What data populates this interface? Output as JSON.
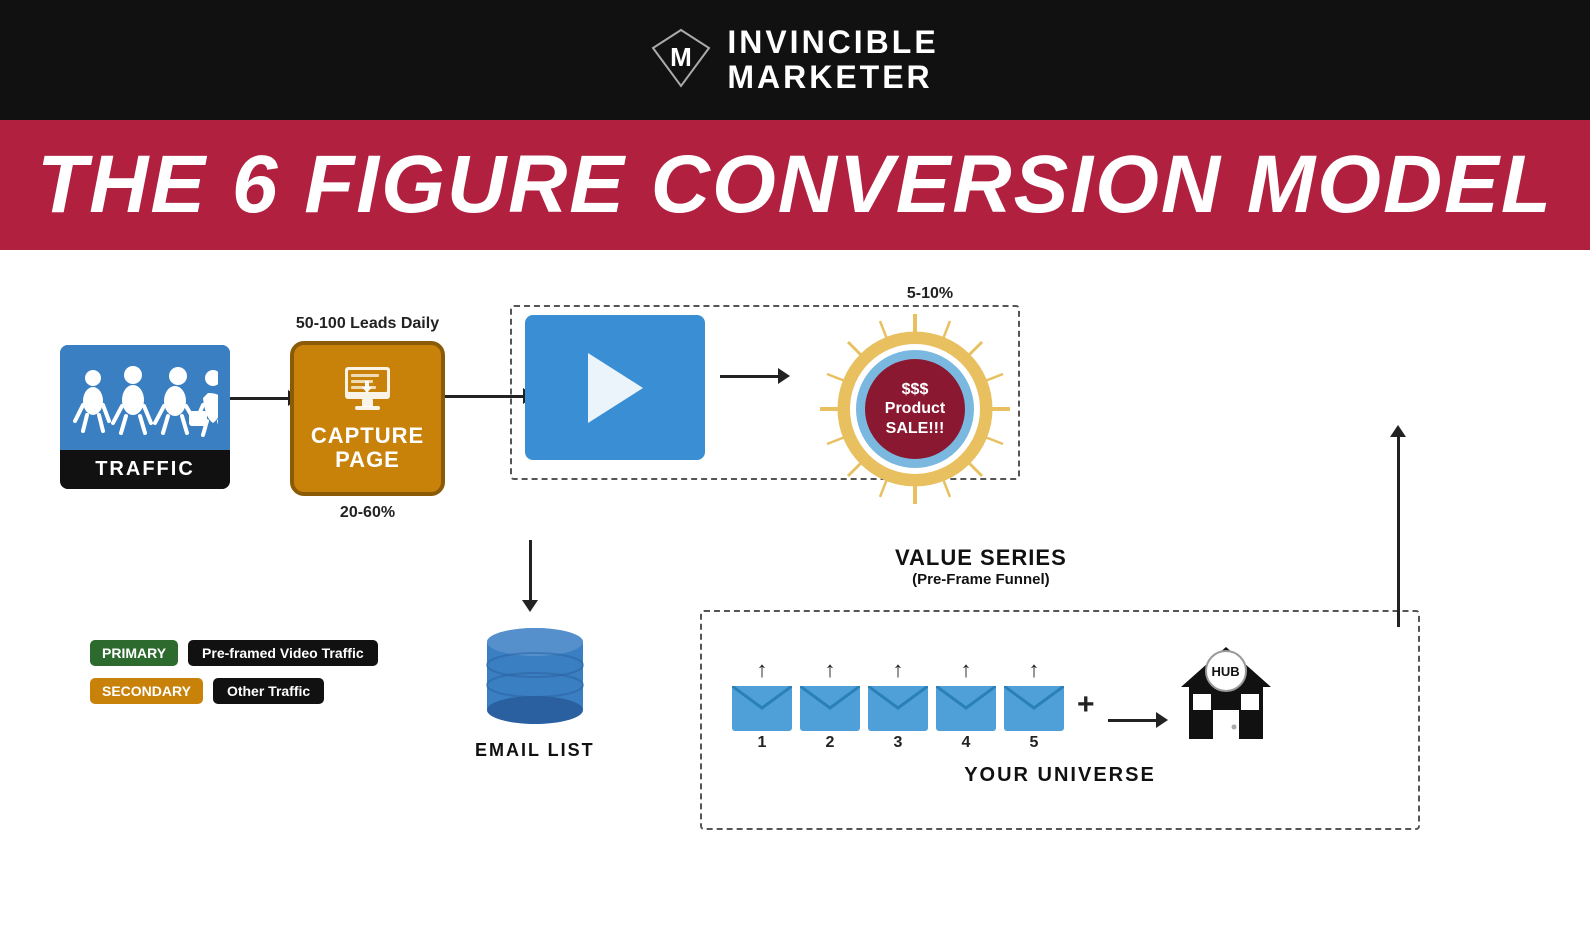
{
  "header": {
    "brand_line1": "INVINCIBLE",
    "brand_line2": "MARKETER"
  },
  "banner": {
    "title": "THE 6 FIGURE CONVERSION MODEL"
  },
  "flow": {
    "traffic_label": "TRAFFIC",
    "leads_label": "50-100 Leads Daily",
    "capture_line1": "CAPTURE",
    "capture_line2": "PAGE",
    "conversion_label": "20-60%",
    "email_list_label": "EMAIL LIST",
    "value_series_label": "VALUE SERIES",
    "value_series_sub": "(Pre-Frame Funnel)",
    "sale_percent": "5-10%",
    "sale_text_line1": "$$$",
    "sale_text_line2": "Product",
    "sale_text_line3": "SALE!!!",
    "universe_label": "YOUR UNIVERSE",
    "hub_label": "HUB",
    "email_numbers": [
      "1",
      "2",
      "3",
      "4",
      "5"
    ],
    "legend": {
      "primary_badge": "PRIMARY",
      "primary_text": "Pre-framed Video Traffic",
      "secondary_badge": "SECONDARY",
      "secondary_text": "Other Traffic"
    }
  },
  "colors": {
    "background": "#ffffff",
    "header_bg": "#111111",
    "banner_bg": "#b22040",
    "traffic_blue": "#3a7fc1",
    "capture_orange": "#c8820a",
    "video_blue": "#3a8fd4",
    "sale_dark": "#8a1830",
    "email_blue": "#4fa0d8",
    "primary_green": "#2d6a2d",
    "secondary_orange": "#c8820a"
  }
}
